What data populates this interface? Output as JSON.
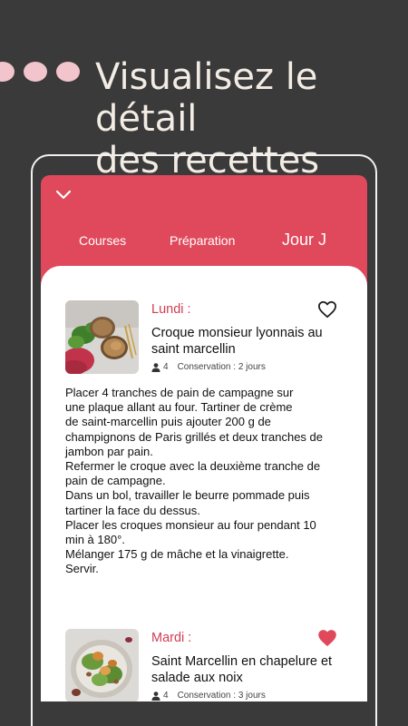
{
  "headline": {
    "line1": "Visualisez le détail",
    "line2": "des recettes"
  },
  "colors": {
    "background": "#3a3a3a",
    "accent": "#e0495c",
    "day_label": "#d23c52",
    "dots": "#f2c4cc"
  },
  "app": {
    "collapse_icon": "chevron-down-icon",
    "tabs": [
      {
        "label": "Courses",
        "active": false
      },
      {
        "label": "Préparation",
        "active": false
      },
      {
        "label": "Jour J",
        "active": true
      }
    ],
    "recipes": [
      {
        "day": "Lundi :",
        "title": "Croque monsieur lyonnais au saint marcellin",
        "servings": "4",
        "conservation": "Conservation : 2 jours",
        "favorite": false,
        "favorite_icon": "heart-outline-icon",
        "instructions": "Placer 4 tranches de pain de campagne sur\nune plaque allant au four. Tartiner de crème\nde saint-marcellin puis ajouter 200 g de\nchampignons de Paris grillés et deux tranches de\njambon par pain.\nRefermer le croque avec la deuxième tranche de\npain de campagne.\nDans un bol, travailler le beurre pommade puis\ntartiner la face du dessus.\nPlacer les croques monsieur au four pendant 10\nmin à 180°.\nMélanger 175 g de mâche et la vinaigrette.\nServir."
      },
      {
        "day": "Mardi :",
        "title": "Saint Marcellin en chapelure et salade aux noix",
        "servings": "4",
        "conservation": "Conservation : 3 jours",
        "favorite": true,
        "favorite_icon": "heart-filled-icon"
      }
    ]
  }
}
